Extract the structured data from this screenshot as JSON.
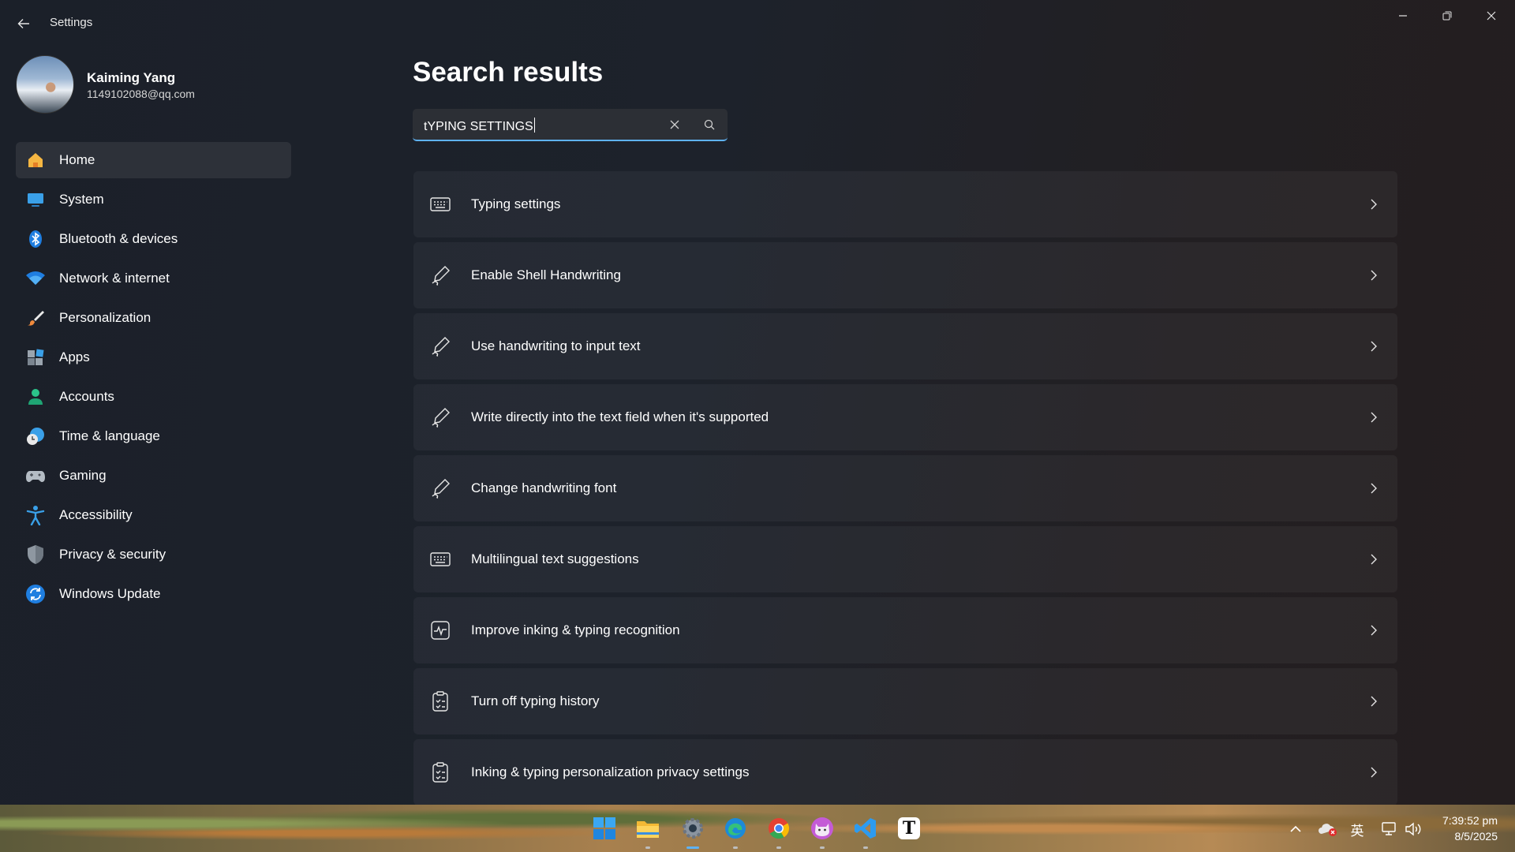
{
  "app": {
    "title": "Settings"
  },
  "profile": {
    "name": "Kaiming Yang",
    "email": "1149102088@qq.com"
  },
  "nav": {
    "items": [
      {
        "label": "Home",
        "icon": "home-icon"
      },
      {
        "label": "System",
        "icon": "system-icon"
      },
      {
        "label": "Bluetooth & devices",
        "icon": "bluetooth-icon"
      },
      {
        "label": "Network & internet",
        "icon": "wifi-icon"
      },
      {
        "label": "Personalization",
        "icon": "brush-icon"
      },
      {
        "label": "Apps",
        "icon": "apps-icon"
      },
      {
        "label": "Accounts",
        "icon": "person-icon"
      },
      {
        "label": "Time & language",
        "icon": "clock-globe-icon"
      },
      {
        "label": "Gaming",
        "icon": "gamepad-icon"
      },
      {
        "label": "Accessibility",
        "icon": "accessibility-icon"
      },
      {
        "label": "Privacy & security",
        "icon": "shield-icon"
      },
      {
        "label": "Windows Update",
        "icon": "update-icon"
      }
    ],
    "active_index": 0
  },
  "main": {
    "title": "Search results",
    "search": {
      "value": "tYPING SETTINGS"
    },
    "results": [
      {
        "label": "Typing settings",
        "icon": "keyboard-icon"
      },
      {
        "label": "Enable Shell Handwriting",
        "icon": "pen-icon"
      },
      {
        "label": "Use handwriting to input text",
        "icon": "pen-icon"
      },
      {
        "label": "Write directly into the text field when it's supported",
        "icon": "pen-icon"
      },
      {
        "label": "Change handwriting font",
        "icon": "pen-icon"
      },
      {
        "label": "Multilingual text suggestions",
        "icon": "keyboard-icon"
      },
      {
        "label": "Improve inking & typing recognition",
        "icon": "activity-icon"
      },
      {
        "label": "Turn off typing history",
        "icon": "clipboard-check-icon"
      },
      {
        "label": "Inking & typing personalization privacy settings",
        "icon": "clipboard-check-icon"
      }
    ]
  },
  "taskbar": {
    "apps": [
      "start-icon",
      "file-explorer-icon",
      "settings-gear-icon",
      "edge-icon",
      "chrome-icon",
      "cat-app-icon",
      "vscode-icon",
      "typora-icon"
    ],
    "typora_letter": "T",
    "ime": "英",
    "clock": {
      "time": "7:39:52 pm",
      "date": "8/5/2025"
    }
  },
  "colors": {
    "accent": "#5fb2f2",
    "active_nav_bg": "#2d3139",
    "card_bg": "#2a2c31"
  }
}
